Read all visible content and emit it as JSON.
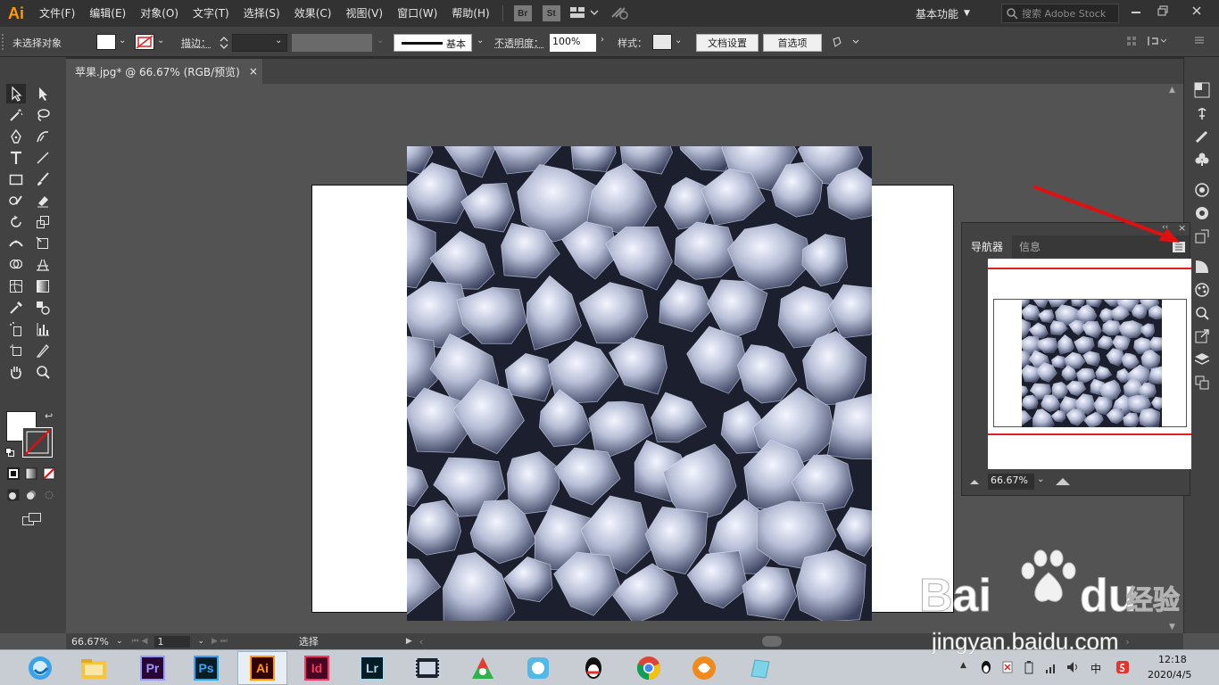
{
  "app": {
    "logo": "Ai",
    "accent": "#ff9a00"
  },
  "menu": [
    "文件(F)",
    "编辑(E)",
    "对象(O)",
    "文字(T)",
    "选择(S)",
    "效果(C)",
    "视图(V)",
    "窗口(W)",
    "帮助(H)"
  ],
  "menubar_chips": [
    "Br",
    "St"
  ],
  "workspace": {
    "label": "基本功能"
  },
  "search": {
    "placeholder": "搜索 Adobe Stock"
  },
  "control": {
    "selection": "未选择对象",
    "stroke_label": "描边：",
    "brush_label": "基本",
    "opacity_label": "不透明度：",
    "opacity_value": "100%",
    "style_label": "样式：",
    "doc_settings": "文档设置",
    "prefs": "首选项"
  },
  "document": {
    "tab_title": "苹果.jpg* @ 66.67% (RGB/预览)"
  },
  "navigator": {
    "tabs": [
      "导航器",
      "信息"
    ],
    "zoom": "66.67%"
  },
  "status": {
    "zoom": "66.67%",
    "page": "1",
    "tool": "选择"
  },
  "taskbar": {
    "apps": [
      "Pr",
      "Ps",
      "Ai",
      "Id",
      "Lr"
    ],
    "time": "12:18",
    "date": "2020/4/5",
    "ime": "中"
  },
  "watermark": {
    "brand_a": "Bai",
    "brand_b": "du",
    "cn": "经验",
    "url": "jingyan.baidu.com"
  },
  "colors": {
    "annotation": "#e01010",
    "pr": "#9999ff",
    "ps": "#31a8ff",
    "ai": "#ff9a00",
    "id": "#ff3366",
    "lr": "#add5ec"
  }
}
